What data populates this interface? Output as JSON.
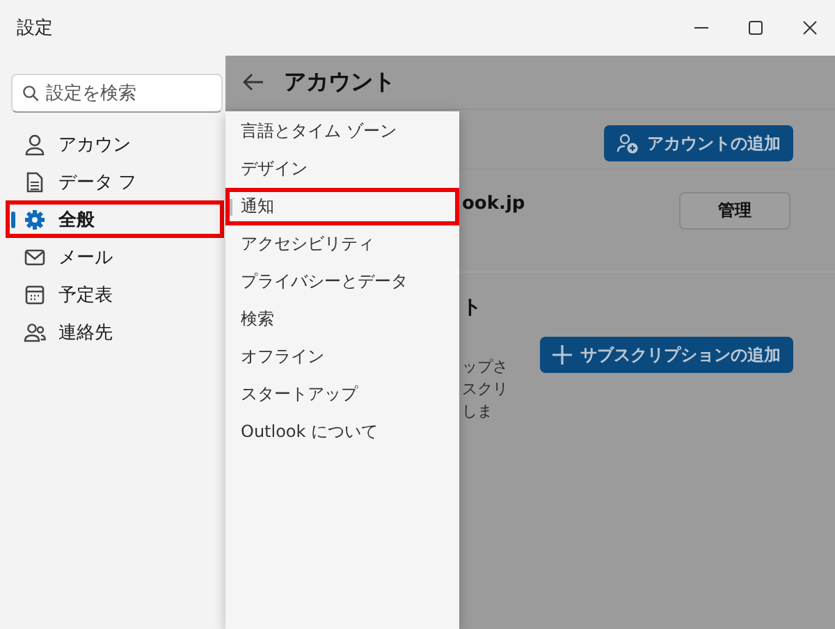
{
  "window": {
    "title": "設定"
  },
  "search": {
    "placeholder": "設定を検索"
  },
  "sidebar": {
    "items": [
      {
        "label": "アカウン",
        "kind": "person",
        "selected": false,
        "highlighted": false
      },
      {
        "label": "データ フ",
        "kind": "document",
        "selected": false,
        "highlighted": false
      },
      {
        "label": "全般",
        "kind": "gear",
        "selected": true,
        "highlighted": true
      },
      {
        "label": "メール",
        "kind": "mail",
        "selected": false,
        "highlighted": false
      },
      {
        "label": "予定表",
        "kind": "calendar",
        "selected": false,
        "highlighted": false
      },
      {
        "label": "連絡先",
        "kind": "people",
        "selected": false,
        "highlighted": false
      }
    ]
  },
  "menu": {
    "items": [
      {
        "label": "言語とタイム ゾーン",
        "selected": false,
        "highlighted": false
      },
      {
        "label": "デザイン",
        "selected": false,
        "highlighted": false
      },
      {
        "label": "通知",
        "selected": true,
        "highlighted": true
      },
      {
        "label": "アクセシビリティ",
        "selected": false,
        "highlighted": false
      },
      {
        "label": "プライバシーとデータ",
        "selected": false,
        "highlighted": false
      },
      {
        "label": "検索",
        "selected": false,
        "highlighted": false
      },
      {
        "label": "オフライン",
        "selected": false,
        "highlighted": false
      },
      {
        "label": "スタートアップ",
        "selected": false,
        "highlighted": false
      },
      {
        "label": "Outlook について",
        "selected": false,
        "highlighted": false
      }
    ]
  },
  "content": {
    "title": "アカウント",
    "add_account_button": "アカウントの追加",
    "email_fragment": "ook.jp",
    "manage_button": "管理",
    "section_fragment": "ト",
    "description_fragments": [
      "ップさ",
      "スクリ",
      "しま"
    ],
    "add_subscription_button": "サブスクリプションの追加"
  }
}
